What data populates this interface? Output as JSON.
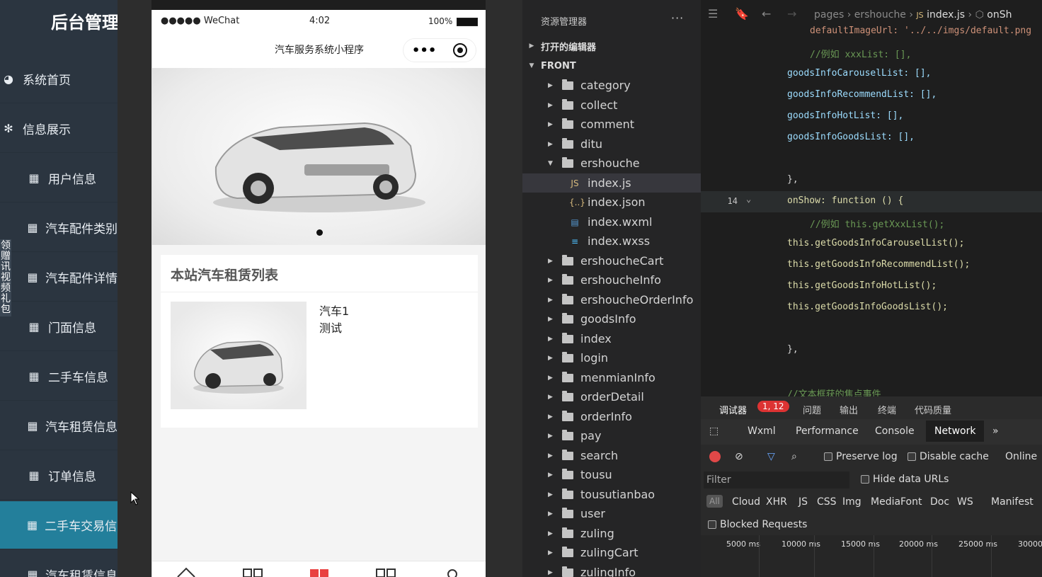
{
  "admin": {
    "title": "后台管理",
    "items": [
      {
        "label": "系统首页",
        "icon": "dashboard-icon"
      },
      {
        "label": "信息展示",
        "icon": "gear-icon"
      },
      {
        "label": "用户信息",
        "icon": "grid-icon"
      },
      {
        "label": "汽车配件类别",
        "icon": "grid-icon"
      },
      {
        "label": "汽车配件详情",
        "icon": "grid-icon"
      },
      {
        "label": "门面信息",
        "icon": "grid-icon"
      },
      {
        "label": "二手车信息",
        "icon": "grid-icon"
      },
      {
        "label": "汽车租赁信息",
        "icon": "grid-icon"
      },
      {
        "label": "订单信息",
        "icon": "grid-icon"
      },
      {
        "label": "二手车交易信息",
        "icon": "grid-icon",
        "active": true
      },
      {
        "label": "汽车租赁信息",
        "icon": "grid-icon"
      }
    ],
    "promo": "领赠讯视频礼包"
  },
  "phone": {
    "status": {
      "signal": "●●●●● WeChat",
      "time": "4:02",
      "battery": "100%"
    },
    "nav_title": "汽车服务系统小程序",
    "capsule_more": "•••",
    "list_title": "本站汽车租赁列表",
    "item": {
      "name": "汽车1",
      "desc": "测试"
    }
  },
  "explorer": {
    "title": "资源管理器",
    "more": "···",
    "open_editors": "打开的编辑器",
    "root": "FRONT",
    "folders_top": [
      "category",
      "collect",
      "comment",
      "ditu",
      "ershouche"
    ],
    "files": [
      {
        "name": "index.js",
        "icon": "JS",
        "color": "#d7ba7d"
      },
      {
        "name": "index.json",
        "icon": "{..}",
        "color": "#d7ba7d"
      },
      {
        "name": "index.wxml",
        "icon": "▤",
        "color": "#569cd6"
      },
      {
        "name": "index.wxss",
        "icon": "≡",
        "color": "#4fc1ff"
      }
    ],
    "folders_bottom": [
      "ershoucheCart",
      "ershoucheInfo",
      "ershoucheOrderInfo",
      "goodsInfo",
      "index",
      "login",
      "menmianInfo",
      "orderDetail",
      "orderInfo",
      "pay",
      "search",
      "tousu",
      "tousutianbao",
      "user",
      "zuling",
      "zulingCart",
      "zulingInfo"
    ]
  },
  "editor": {
    "breadcrumb": [
      "pages",
      "ershouche",
      "index.js",
      "onSh"
    ],
    "lines": [
      {
        "ln": "",
        "text": "defaultImageUrl: '../../imgs/default.png",
        "indent": 154,
        "color": "#ce9178"
      },
      {
        "ln": "",
        "text": "//例如 xxxList: [],",
        "indent": 154,
        "color": "#6a9955"
      },
      {
        "ln": "",
        "text": "goodsInfoCarouselList: [],",
        "indent": 122,
        "color": "#9cdcfe"
      },
      {
        "ln": "",
        "text": "goodsInfoRecommendList: [],",
        "indent": 122,
        "color": "#9cdcfe"
      },
      {
        "ln": "",
        "text": "goodsInfoHotList: [],",
        "indent": 122,
        "color": "#9cdcfe"
      },
      {
        "ln": "",
        "text": "goodsInfoGoodsList: [],",
        "indent": 122,
        "color": "#9cdcfe"
      },
      {
        "ln": "",
        "text": "",
        "indent": 122,
        "color": "#d4d4d4"
      },
      {
        "ln": "",
        "text": "},",
        "indent": 122,
        "color": "#d4d4d4"
      },
      {
        "ln": "14",
        "text": "onShow: function () {",
        "indent": 122,
        "color": "#dcdcaa",
        "hl": true
      },
      {
        "ln": "",
        "text": "//例如 this.getXxxList();",
        "indent": 154,
        "color": "#6a9955"
      },
      {
        "ln": "",
        "text": "this.getGoodsInfoCarouselList();",
        "indent": 122,
        "color": "#dcdcaa"
      },
      {
        "ln": "",
        "text": "this.getGoodsInfoRecommendList();",
        "indent": 122,
        "color": "#dcdcaa"
      },
      {
        "ln": "",
        "text": "this.getGoodsInfoHotList();",
        "indent": 122,
        "color": "#dcdcaa"
      },
      {
        "ln": "",
        "text": "this.getGoodsInfoGoodsList();",
        "indent": 122,
        "color": "#dcdcaa"
      },
      {
        "ln": "",
        "text": "",
        "indent": 122,
        "color": "#d4d4d4"
      },
      {
        "ln": "",
        "text": "},",
        "indent": 122,
        "color": "#d4d4d4"
      },
      {
        "ln": "",
        "text": "",
        "indent": 122,
        "color": "#d4d4d4"
      },
      {
        "ln": "",
        "text": "//文本框获的焦点事件",
        "indent": 122,
        "color": "#6a9955"
      }
    ]
  },
  "devtools": {
    "tabs1": [
      "调试器",
      "问题",
      "输出",
      "终端",
      "代码质量"
    ],
    "badge": "1, 12",
    "tabs2": [
      "Wxml",
      "Performance",
      "Console",
      "Network"
    ],
    "active_tab": "Network",
    "preserve_log": "Preserve log",
    "disable_cache": "Disable cache",
    "online": "Online",
    "filter_placeholder": "Filter",
    "hide_data_urls": "Hide data URLs",
    "types": [
      "All",
      "Cloud",
      "XHR",
      "JS",
      "CSS",
      "Img",
      "Media",
      "Font",
      "Doc",
      "WS",
      "Manifest"
    ],
    "blocked": "Blocked Requests",
    "timeline": [
      "5000 ms",
      "10000 ms",
      "15000 ms",
      "20000 ms",
      "25000 ms",
      "30000"
    ]
  }
}
